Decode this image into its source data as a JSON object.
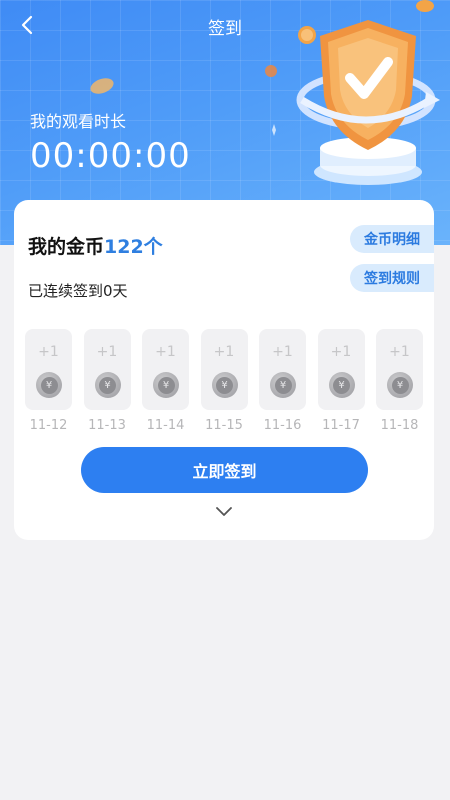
{
  "header": {
    "title": "签到",
    "back_icon": "chevron-left-icon"
  },
  "watch": {
    "label": "我的观看时长",
    "time": "00:00:00"
  },
  "coins": {
    "prefix": "我的金币",
    "count": "122个",
    "streak": "已连续签到0天",
    "detail_label": "金币明细",
    "rules_label": "签到规则"
  },
  "days": [
    {
      "reward": "+1",
      "date": "11-12"
    },
    {
      "reward": "+1",
      "date": "11-13"
    },
    {
      "reward": "+1",
      "date": "11-14"
    },
    {
      "reward": "+1",
      "date": "11-15"
    },
    {
      "reward": "+1",
      "date": "11-16"
    },
    {
      "reward": "+1",
      "date": "11-17"
    },
    {
      "reward": "+1",
      "date": "11-18"
    }
  ],
  "coin_symbol": "¥",
  "signin_button": "立即签到",
  "expand_icon": "chevron-down-icon",
  "colors": {
    "accent": "#2d7ff1",
    "header_blue": "#4f9cf8",
    "coin_count": "#2f7fe0",
    "pill_bg": "#d9ebfd"
  }
}
